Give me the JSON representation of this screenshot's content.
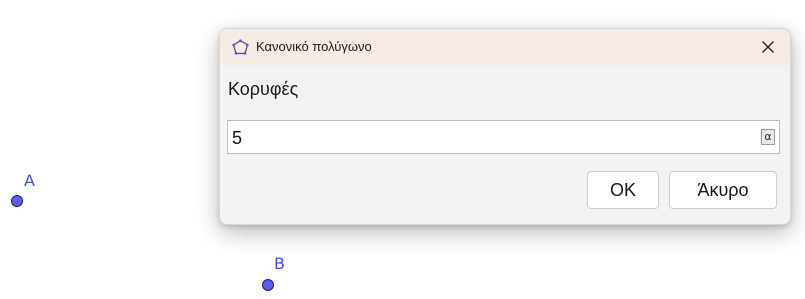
{
  "canvas": {
    "points": [
      {
        "label": "A",
        "color": "#5b5bf0"
      },
      {
        "label": "B",
        "color": "#5b5bf0"
      }
    ]
  },
  "dialog": {
    "title": "Κανονικό πολύγωνο",
    "title_icon": "regular-polygon-icon",
    "close_icon": "close-icon",
    "titlebar_color": "#f6ebe5",
    "field_label": "Κορυφές",
    "input_value": "5",
    "symbol_button": "α",
    "ok_label": "OK",
    "cancel_label": "Άκυρο"
  }
}
